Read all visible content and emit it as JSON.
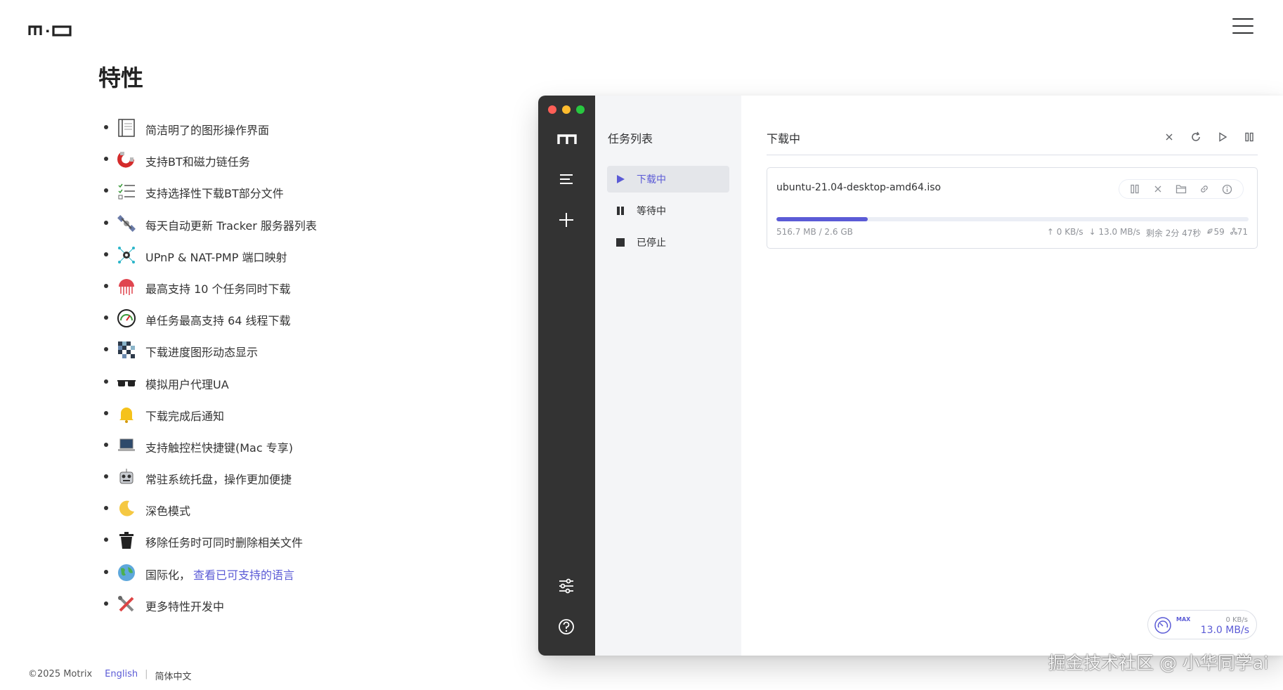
{
  "header": {
    "logo_icon": "motrix-logo-icon",
    "menu_icon": "hamburger-menu-icon"
  },
  "features": {
    "title": "特性",
    "items": [
      {
        "icon": "document-icon",
        "text": "简洁明了的图形操作界面"
      },
      {
        "icon": "magnet-icon",
        "text": "支持BT和磁力链任务"
      },
      {
        "icon": "checklist-icon",
        "text": "支持选择性下载BT部分文件"
      },
      {
        "icon": "satellite-icon",
        "text": "每天自动更新 Tracker 服务器列表"
      },
      {
        "icon": "network-gear-icon",
        "text": "UPnP & NAT-PMP 端口映射"
      },
      {
        "icon": "jellyfish-icon",
        "text": "最高支持 10 个任务同时下载"
      },
      {
        "icon": "speedometer-icon",
        "text": "单任务最高支持 64 线程下载"
      },
      {
        "icon": "pixel-grid-icon",
        "text": "下载进度图形动态显示"
      },
      {
        "icon": "sunglasses-icon",
        "text": "模拟用户代理UA"
      },
      {
        "icon": "bell-icon",
        "text": "下载完成后通知"
      },
      {
        "icon": "laptop-icon",
        "text": "支持触控栏快捷键(Mac 专享)"
      },
      {
        "icon": "robot-icon",
        "text": "常驻系统托盘，操作更加便捷"
      },
      {
        "icon": "moon-icon",
        "text": "深色模式"
      },
      {
        "icon": "trash-icon",
        "text": "移除任务时可同时删除相关文件"
      },
      {
        "icon": "globe-icon",
        "text": "国际化，",
        "link": "查看已可支持的语言"
      },
      {
        "icon": "tools-icon",
        "text": "更多特性开发中"
      }
    ]
  },
  "footer": {
    "copyright": "©2025 Motrix",
    "lang_en": "English",
    "separator": "|",
    "lang_zh": "简体中文"
  },
  "app": {
    "sidebar": {
      "logo_icon": "motrix-m-icon",
      "buttons": [
        "menu-icon",
        "plus-icon",
        "settings-sliders-icon",
        "help-icon"
      ]
    },
    "subnav": {
      "title": "任务列表",
      "items": [
        {
          "label": "下载中",
          "icon": "play-icon",
          "active": true
        },
        {
          "label": "等待中",
          "icon": "pause-icon",
          "active": false
        },
        {
          "label": "已停止",
          "icon": "stop-icon",
          "active": false
        }
      ]
    },
    "main": {
      "title": "下载中",
      "actions": [
        "close-icon",
        "refresh-icon",
        "play-icon",
        "pause-icon"
      ]
    },
    "task": {
      "name": "ubuntu-21.04-desktop-amd64.iso",
      "progress": 0.194,
      "size": "516.7 MB / 2.6 GB",
      "upload": "↑ 0 KB/s",
      "download": "↓ 13.0 MB/s",
      "remaining": "剩余 2分 47秒",
      "seeders": "59",
      "connections": "71",
      "actions": [
        "pause-icon",
        "close-icon",
        "folder-icon",
        "link-icon",
        "info-icon"
      ]
    },
    "speedometer": {
      "mode": "MAX",
      "upload": "0 KB/s",
      "download": "13.0 MB/s"
    }
  },
  "watermark": "掘金技术社区 @ 小华同学ai",
  "colors": {
    "accent": "#5b5bd6",
    "sidebar_bg": "#333333",
    "subnav_bg": "#f4f5f7",
    "traffic_red": "#ff5f57",
    "traffic_yellow": "#febc2e",
    "traffic_green": "#28c840"
  }
}
